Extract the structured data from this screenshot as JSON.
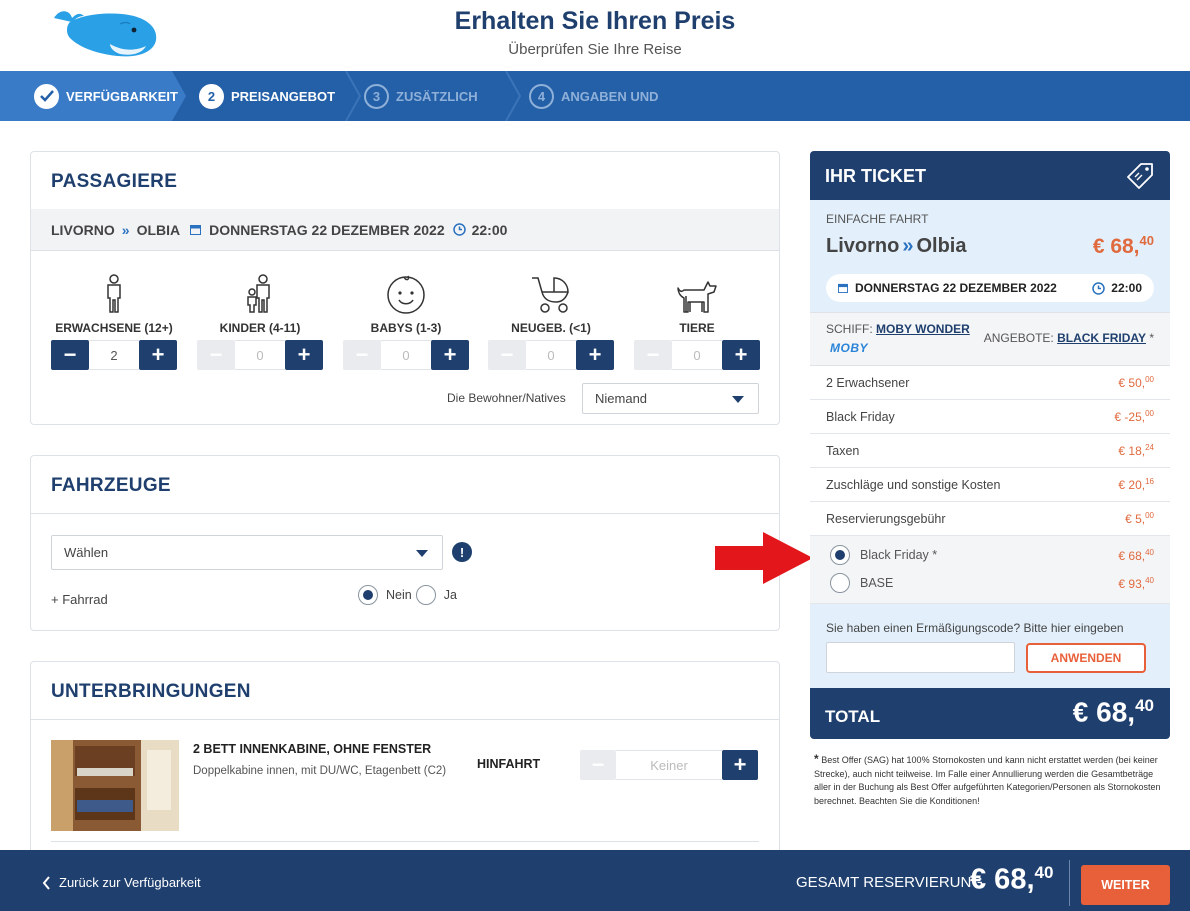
{
  "header": {
    "title": "Erhalten Sie Ihren Preis",
    "subtitle": "Überprüfen Sie Ihre Reise"
  },
  "steps": [
    {
      "number": "",
      "label": "VERFÜGBARKEIT",
      "state": "done"
    },
    {
      "number": "2",
      "label": "PREISANGEBOT",
      "state": "active"
    },
    {
      "number": "3",
      "label": "ZUSÄTZLICH",
      "state": "upcoming"
    },
    {
      "number": "4",
      "label": "ANGABEN UND",
      "state": "upcoming"
    }
  ],
  "passengers": {
    "title": "PASSAGIERE",
    "route": {
      "from": "LIVORNO",
      "to": "OLBIA",
      "date": "DONNERSTAG 22 DEZEMBER 2022",
      "time": "22:00"
    },
    "types": [
      {
        "icon": "adult-icon",
        "label": "ERWACHSENE (12+)",
        "value": "2",
        "minus_enabled": true
      },
      {
        "icon": "child-icon",
        "label": "KINDER (4-11)",
        "value": "0",
        "minus_enabled": false
      },
      {
        "icon": "baby-icon",
        "label": "BABYS (1-3)",
        "value": "0",
        "minus_enabled": false
      },
      {
        "icon": "stroller-icon",
        "label": "NEUGEB. (<1)",
        "value": "0",
        "minus_enabled": false
      },
      {
        "icon": "dog-icon",
        "label": "TIERE",
        "value": "0",
        "minus_enabled": false
      }
    ],
    "natives_label": "Die Bewohner/Natives",
    "natives_value": "Niemand"
  },
  "vehicles": {
    "title": "FAHRZEUGE",
    "select_value": "Wählen",
    "bike_label": "+ Fahrrad",
    "options": [
      "Nein",
      "Ja"
    ],
    "selected": "Nein"
  },
  "accommodations": {
    "title": "UNTERBRINGUNGEN",
    "cabin_name": "2 BETT INNENKABINE, OHNE FENSTER",
    "cabin_desc": "Doppelkabine innen, mit DU/WC, Etagenbett (C2)",
    "direction": "HINFAHRT",
    "stepper_value": "Keiner"
  },
  "ticket": {
    "title": "IHR TICKET",
    "trip_type": "EINFACHE FAHRT",
    "from": "Livorno",
    "to": "Olbia",
    "price_main": "€ 68,",
    "price_cents": "40",
    "date": "DONNERSTAG 22 DEZEMBER 2022",
    "time": "22:00",
    "ship_label": "SCHIFF:",
    "ship_name": "MOBY WONDER",
    "ship_logo": "MOBY",
    "offer_label": "ANGEBOTE:",
    "offer_name": "BLACK FRIDAY",
    "offer_star": "*",
    "lines": [
      {
        "label": "2 Erwachsener",
        "amount": "€ 50,",
        "cents": "00"
      },
      {
        "label": "Black Friday",
        "amount": "€ -25,",
        "cents": "00"
      },
      {
        "label": "Taxen",
        "amount": "€ 18,",
        "cents": "24"
      },
      {
        "label": "Zuschläge und sonstige Kosten",
        "amount": "€ 20,",
        "cents": "16"
      },
      {
        "label": "Reservierungsgebühr",
        "amount": "€ 5,",
        "cents": "00"
      }
    ],
    "offers": [
      {
        "label": "Black Friday *",
        "amount": "€ 68,",
        "cents": "40",
        "selected": true
      },
      {
        "label": "BASE",
        "amount": "€ 93,",
        "cents": "40",
        "selected": false
      }
    ],
    "code_prompt": "Sie haben einen Ermäßigungscode? Bitte hier eingeben",
    "code_placeholder": "",
    "apply_label": "ANWENDEN",
    "total_label": "TOTAL",
    "total_main": "€ 68,",
    "total_cents": "40"
  },
  "footnote": {
    "star": "*",
    "text": "Best Offer (SAG) hat 100% Stornokosten und kann nicht erstattet werden (bei keiner Strecke), auch nicht teilweise. Im Falle einer Annullierung werden die Gesamtbeträge aller in der Buchung als Best Offer aufgeführten Kategorien/Personen als Stornokosten berechnet. Beachten Sie die Konditionen!"
  },
  "footer": {
    "back_label": "Zurück zur Verfügbarkeit",
    "total_label": "GESAMT RESERVIERUNG",
    "total_main": "€ 68,",
    "total_cents": "40",
    "next_label": "WEITER"
  },
  "colors": {
    "navy": "#1f3f6e",
    "step_blue": "#2460a8",
    "accent_orange": "#e8603a",
    "light_blue": "#e3f0fb",
    "arrow_red": "#e3161b"
  }
}
